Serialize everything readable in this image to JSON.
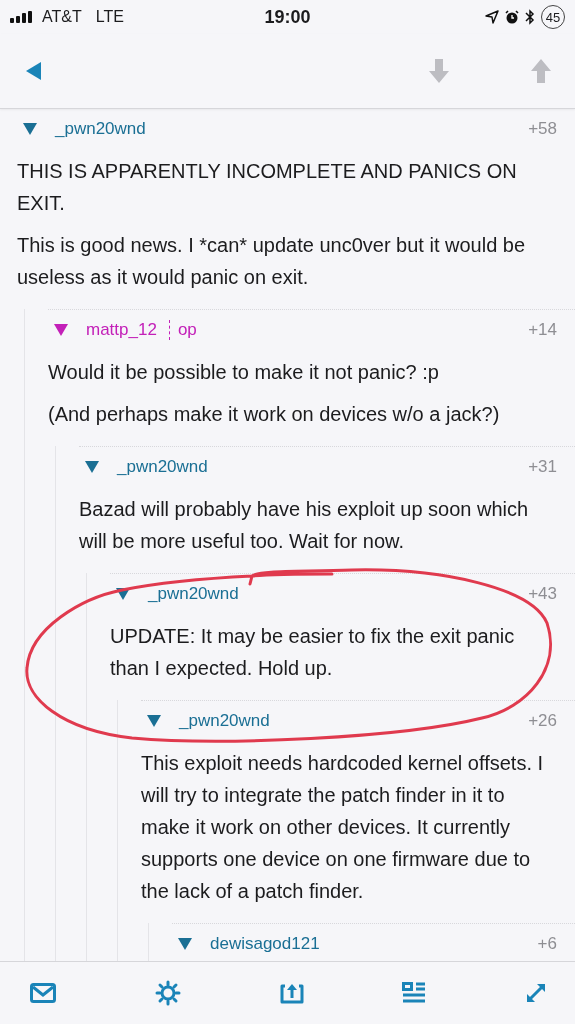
{
  "status_bar": {
    "carrier": "AT&T",
    "network": "LTE",
    "time": "19:00",
    "battery": "45"
  },
  "comments": [
    {
      "author": "_pwn20wnd",
      "is_op": false,
      "score": "+58",
      "expanded": true,
      "paragraphs": [
        "THIS IS APPARENTLY INCOMPLETE AND PANICS ON EXIT.",
        "This is good news. I *can* update unc0ver but it would be useless as it would panic on exit."
      ],
      "children": [
        {
          "author": "mattp_12",
          "is_op": true,
          "flair": "op",
          "score": "+14",
          "expanded": true,
          "paragraphs": [
            "Would it be possible to make it not panic? :p",
            "(And perhaps make it work on devices w/o a jack?)"
          ],
          "children": [
            {
              "author": "_pwn20wnd",
              "is_op": false,
              "score": "+31",
              "expanded": true,
              "paragraphs": [
                "Bazad will probably have his exploit up soon which will be more useful too. Wait for now."
              ],
              "children": [
                {
                  "author": "_pwn20wnd",
                  "is_op": false,
                  "score": "+43",
                  "expanded": true,
                  "paragraphs": [
                    "UPDATE: It may be easier to fix the exit panic than I expected. Hold up."
                  ],
                  "children": [
                    {
                      "author": "_pwn20wnd",
                      "is_op": false,
                      "score": "+26",
                      "expanded": true,
                      "paragraphs": [
                        "This exploit needs hardcoded kernel offsets. I will try to integrate the patch finder in it to make it work on other devices. It currently supports one device on one firmware due to the lack of a patch finder."
                      ],
                      "children": [
                        {
                          "author": "dewisagod121",
                          "is_op": false,
                          "score": "+6",
                          "expanded": true
                        }
                      ]
                    }
                  ]
                }
              ]
            }
          ]
        }
      ]
    }
  ]
}
